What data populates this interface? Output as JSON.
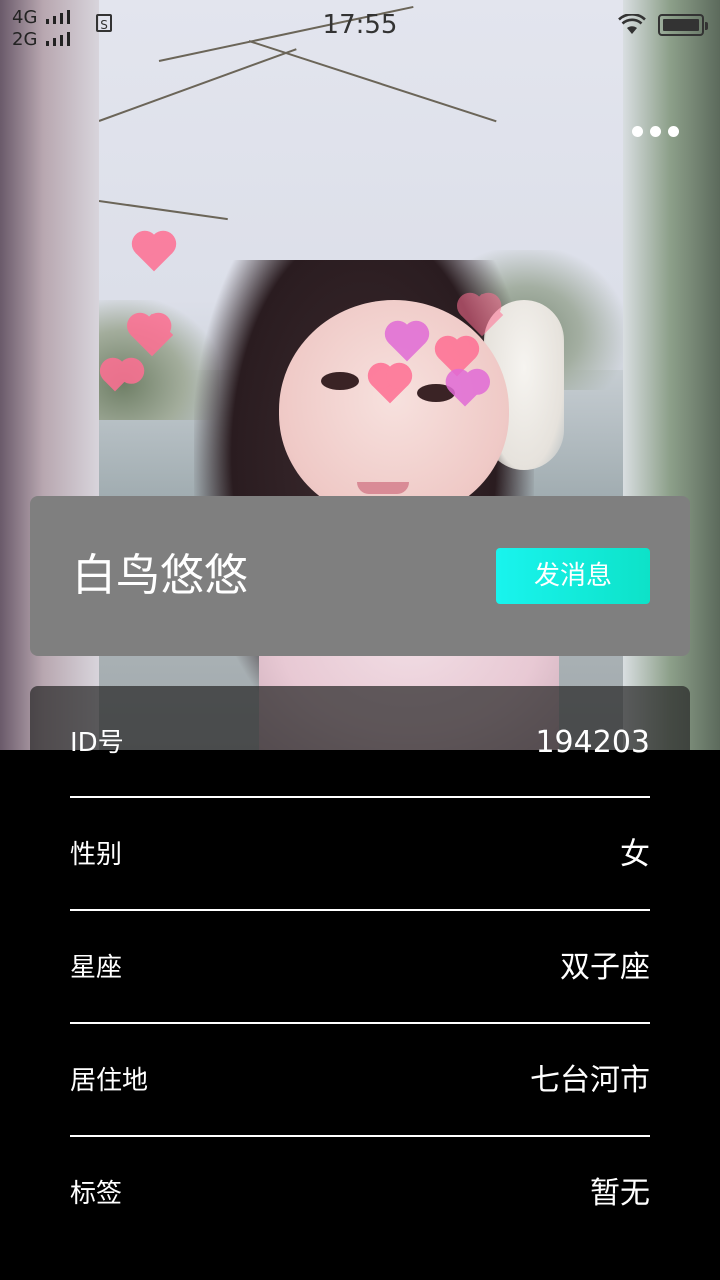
{
  "status_bar": {
    "network_1": "4G",
    "network_2": "2G",
    "sim_label": "S",
    "time": "17:55"
  },
  "profile": {
    "name": "白鸟悠悠",
    "message_button": "发消息"
  },
  "info": [
    {
      "label": "ID号",
      "value": "194203"
    },
    {
      "label": "性别",
      "value": "女"
    },
    {
      "label": "星座",
      "value": "双子座"
    },
    {
      "label": "居住地",
      "value": "七台河市"
    },
    {
      "label": "标签",
      "value": "暂无"
    }
  ],
  "colors": {
    "button_gradient_start": "#19f4ee",
    "button_gradient_end": "#0de2c8",
    "card_background": "#7f7f7f",
    "page_background": "#000000"
  }
}
